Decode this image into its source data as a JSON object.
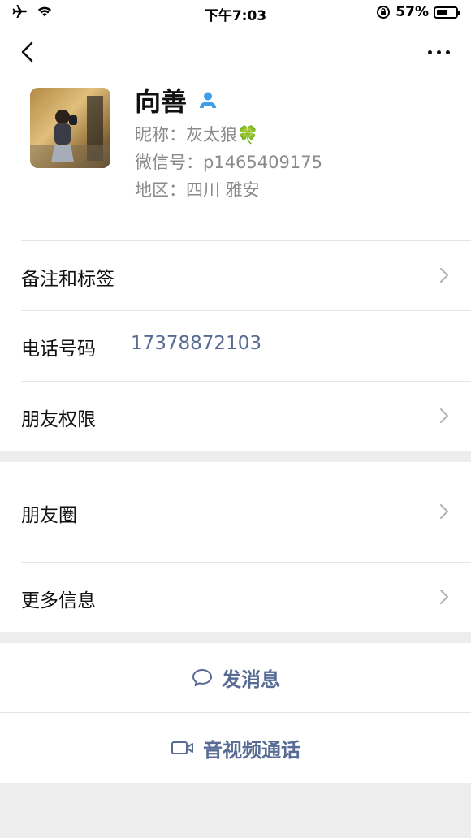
{
  "status_bar": {
    "time": "下午7:03",
    "battery_text": "57%",
    "battery_level": 0.57,
    "icons": [
      "airplane-icon",
      "wifi-icon",
      "orientation-lock-icon",
      "battery-icon"
    ]
  },
  "nav": {
    "back_icon": "chevron-left-icon",
    "more_icon": "more-dots-icon"
  },
  "profile": {
    "name": "向善",
    "nickname": "昵称：灰太狼🍀",
    "wechat_id": "微信号：p1465409175",
    "region": "地区：四川 雅安",
    "name_badge_icon": "contact-person-icon"
  },
  "rows": {
    "notes_tags": "备注和标签",
    "phone_label": "电话号码",
    "phone_value": "17378872103",
    "friend_perms": "朋友权限",
    "moments": "朋友圈",
    "more_info": "更多信息"
  },
  "actions": {
    "send_message": "发消息",
    "av_call": "音视频通话"
  },
  "colors": {
    "link": "#576b95",
    "separator_bg": "#ededed",
    "badge_blue": "#3f9ee8"
  }
}
